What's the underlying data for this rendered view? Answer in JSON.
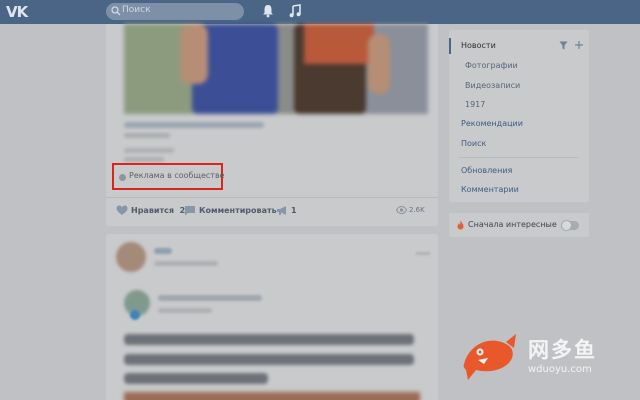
{
  "header": {
    "logo_text": "VK",
    "search_placeholder": "Поиск",
    "icons": [
      "vk-logo-icon",
      "search-icon",
      "bell-icon",
      "music-icon"
    ]
  },
  "feed": {
    "post1": {
      "ad_label": "Реклама в сообществе",
      "actions": {
        "like_label": "Нравится",
        "like_count": "2",
        "comment_label": "Комментировать",
        "repost_count": "1",
        "views": "2.6K"
      }
    }
  },
  "sidebar": {
    "items": [
      {
        "label": "Новости"
      },
      {
        "label": "Фотографии"
      },
      {
        "label": "Видеозаписи"
      },
      {
        "label": "1917"
      },
      {
        "label": "Рекомендации"
      },
      {
        "label": "Поиск"
      },
      {
        "label": "Обновления"
      },
      {
        "label": "Комментарии"
      }
    ],
    "interesting_label": "Сначала интересные",
    "interesting_enabled": false
  },
  "watermark": {
    "brand_cn": "网多鱼",
    "url": "wduoyu.com"
  },
  "colors": {
    "header_bg": "#4a6585",
    "page_bg": "#bfc1c4",
    "card_bg": "#c9cacc",
    "highlight_red": "#d9261c",
    "watermark_orange": "#e8582a"
  }
}
